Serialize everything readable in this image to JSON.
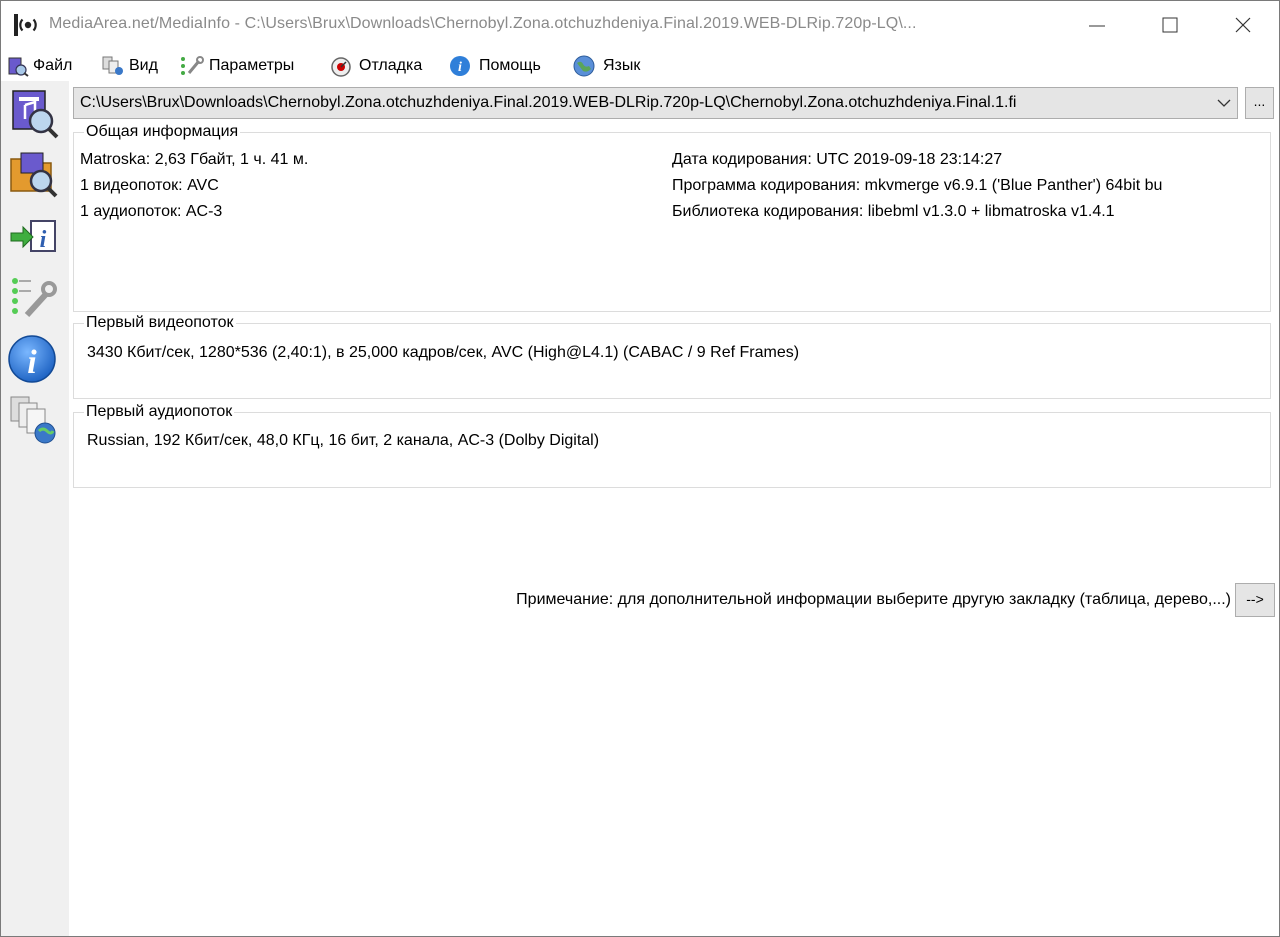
{
  "window": {
    "title": "MediaArea.net/MediaInfo - C:\\Users\\Brux\\Downloads\\Chernobyl.Zona.otchuzhdeniya.Final.2019.WEB-DLRip.720p-LQ\\..."
  },
  "menu": {
    "items": [
      {
        "label": "Файл",
        "icon": "file-icon"
      },
      {
        "label": "Вид",
        "icon": "view-icon"
      },
      {
        "label": "Параметры",
        "icon": "options-icon"
      },
      {
        "label": "Отладка",
        "icon": "debug-icon"
      },
      {
        "label": "Помощь",
        "icon": "help-icon"
      },
      {
        "label": "Язык",
        "icon": "language-icon"
      }
    ]
  },
  "toolbar": {
    "buttons": [
      "open-file-icon",
      "open-folder-icon",
      "export-icon",
      "preferences-icon",
      "about-icon",
      "knowledge-base-icon"
    ]
  },
  "file_selector": {
    "value": "C:\\Users\\Brux\\Downloads\\Chernobyl.Zona.otchuzhdeniya.Final.2019.WEB-DLRip.720p-LQ\\Chernobyl.Zona.otchuzhdeniya.Final.1.fi",
    "browse_label": "..."
  },
  "general": {
    "title": "Общая информация",
    "left": [
      "Matroska: 2,63 Гбайт, 1 ч. 41 м.",
      "1 видеопоток: AVC",
      "1 аудиопоток: AC-3"
    ],
    "right": [
      "Дата кодирования: UTC 2019-09-18 23:14:27",
      "Программа кодирования: mkvmerge v6.9.1 ('Blue Panther') 64bit bu",
      "Библиотека кодирования: libebml v1.3.0 + libmatroska v1.4.1"
    ]
  },
  "video": {
    "title": "Первый видеопоток",
    "line": "3430 Кбит/сек, 1280*536 (2,40:1), в 25,000 кадров/сек, AVC (High@L4.1) (CABAC / 9 Ref Frames)"
  },
  "audio": {
    "title": "Первый аудиопоток",
    "line": "Russian, 192 Кбит/сек, 48,0 КГц, 16 бит, 2 канала, AC-3 (Dolby Digital)"
  },
  "note": {
    "text": "Примечание: для дополнительной информации выберите другую закладку (таблица, дерево,...)",
    "button_label": "-->"
  }
}
